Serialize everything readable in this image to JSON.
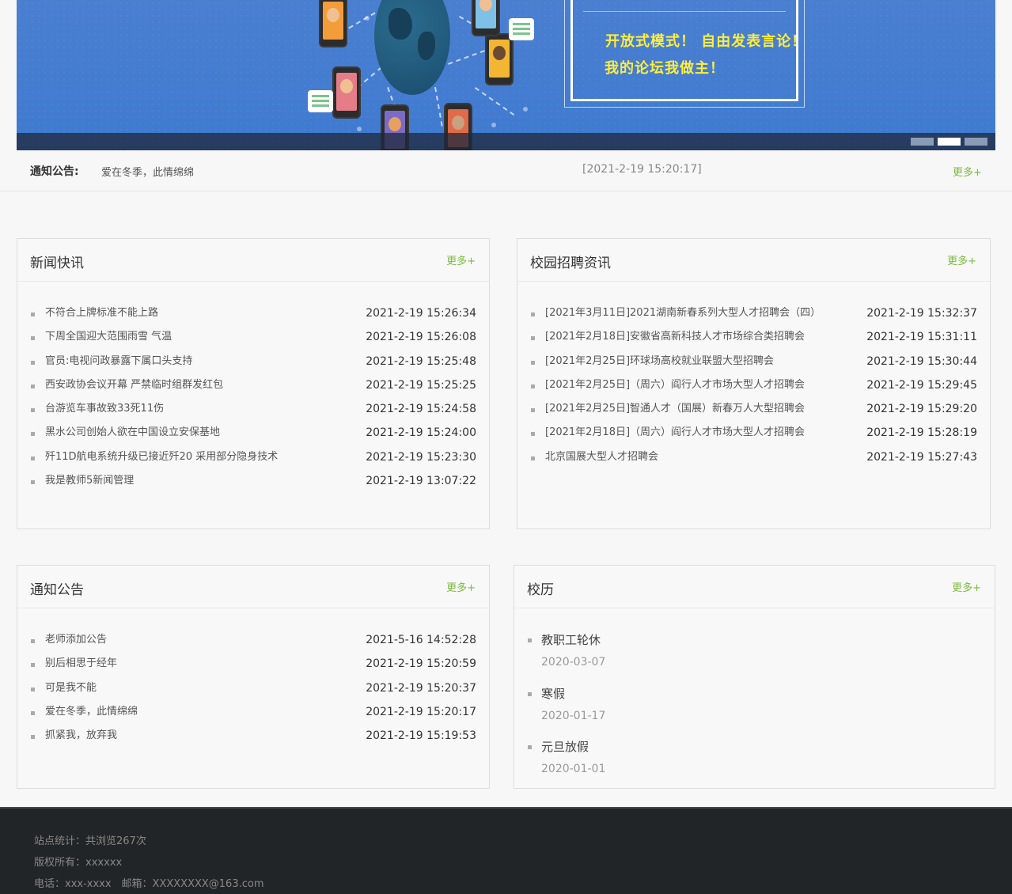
{
  "banner": {
    "slogan_line1": "开放式模式！ 自由发表言论！",
    "slogan_line2": "我的论坛我做主！",
    "slide_count": 3,
    "active_slide": 2
  },
  "notice_strip": {
    "label": "通知公告:",
    "text": "爱在冬季，此情绵绵",
    "time": "[2021-2-19 15:20:17]",
    "more": "更多+"
  },
  "news": {
    "title": "新闻快讯",
    "more": "更多+",
    "items": [
      {
        "title": "不符合上牌标准不能上路",
        "time": "2021-2-19 15:26:34"
      },
      {
        "title": "下周全国迎大范围雨雪 气温",
        "time": "2021-2-19 15:26:08"
      },
      {
        "title": "官员:电视问政暴露下属口头支持",
        "time": "2021-2-19 15:25:48"
      },
      {
        "title": "西安政协会议开幕 严禁临时组群发红包",
        "time": "2021-2-19 15:25:25"
      },
      {
        "title": "台游览车事故致33死11伤",
        "time": "2021-2-19 15:24:58"
      },
      {
        "title": "黑水公司创始人欲在中国设立安保基地",
        "time": "2021-2-19 15:24:00"
      },
      {
        "title": "歼11D航电系统升级已接近歼20 采用部分隐身技术",
        "time": "2021-2-19 15:23:30"
      },
      {
        "title": "我是教师5新闻管理",
        "time": "2021-2-19 13:07:22"
      }
    ]
  },
  "recruit": {
    "title": "校园招聘资讯",
    "more": "更多+",
    "items": [
      {
        "title": "[2021年3月11日]2021湖南新春系列大型人才招聘会（四）",
        "time": "2021-2-19 15:32:37"
      },
      {
        "title": "[2021年2月18日]安徽省高新科技人才市场综合类招聘会",
        "time": "2021-2-19 15:31:11"
      },
      {
        "title": "[2021年2月25日]环球场高校就业联盟大型招聘会",
        "time": "2021-2-19 15:30:44"
      },
      {
        "title": "[2021年2月25日]（周六）阎行人才市场大型人才招聘会",
        "time": "2021-2-19 15:29:45"
      },
      {
        "title": "[2021年2月25日]智通人才（国展）新春万人大型招聘会",
        "time": "2021-2-19 15:29:20"
      },
      {
        "title": "[2021年2月18日]（周六）阎行人才市场大型人才招聘会",
        "time": "2021-2-19 15:28:19"
      },
      {
        "title": "北京国展大型人才招聘会",
        "time": "2021-2-19 15:27:43"
      }
    ]
  },
  "notices": {
    "title": "通知公告",
    "more": "更多+",
    "items": [
      {
        "title": "老师添加公告",
        "time": "2021-5-16 14:52:28"
      },
      {
        "title": "别后相思于经年",
        "time": "2021-2-19 15:20:59"
      },
      {
        "title": "可是我不能",
        "time": "2021-2-19 15:20:37"
      },
      {
        "title": "爱在冬季，此情绵绵",
        "time": "2021-2-19 15:20:17"
      },
      {
        "title": "抓紧我，放弃我",
        "time": "2021-2-19 15:19:53"
      }
    ]
  },
  "calendar": {
    "title": "校历",
    "more": "更多+",
    "items": [
      {
        "name": "教职工轮休",
        "date": "2020-03-07"
      },
      {
        "name": "寒假",
        "date": "2020-01-17"
      },
      {
        "name": "元旦放假",
        "date": "2020-01-01"
      }
    ]
  },
  "footer": {
    "stats": "站点统计：共浏览267次",
    "copyright": "版权所有：xxxxxx",
    "contact": "电话：xxx-xxxx　邮箱：XXXXXXXX@163.com"
  },
  "colors": {
    "accent_green": "#7cba3c",
    "banner_blue": "#3f7ad0",
    "slogan_yellow": "#ffee3a",
    "footer_bg": "#222527"
  }
}
